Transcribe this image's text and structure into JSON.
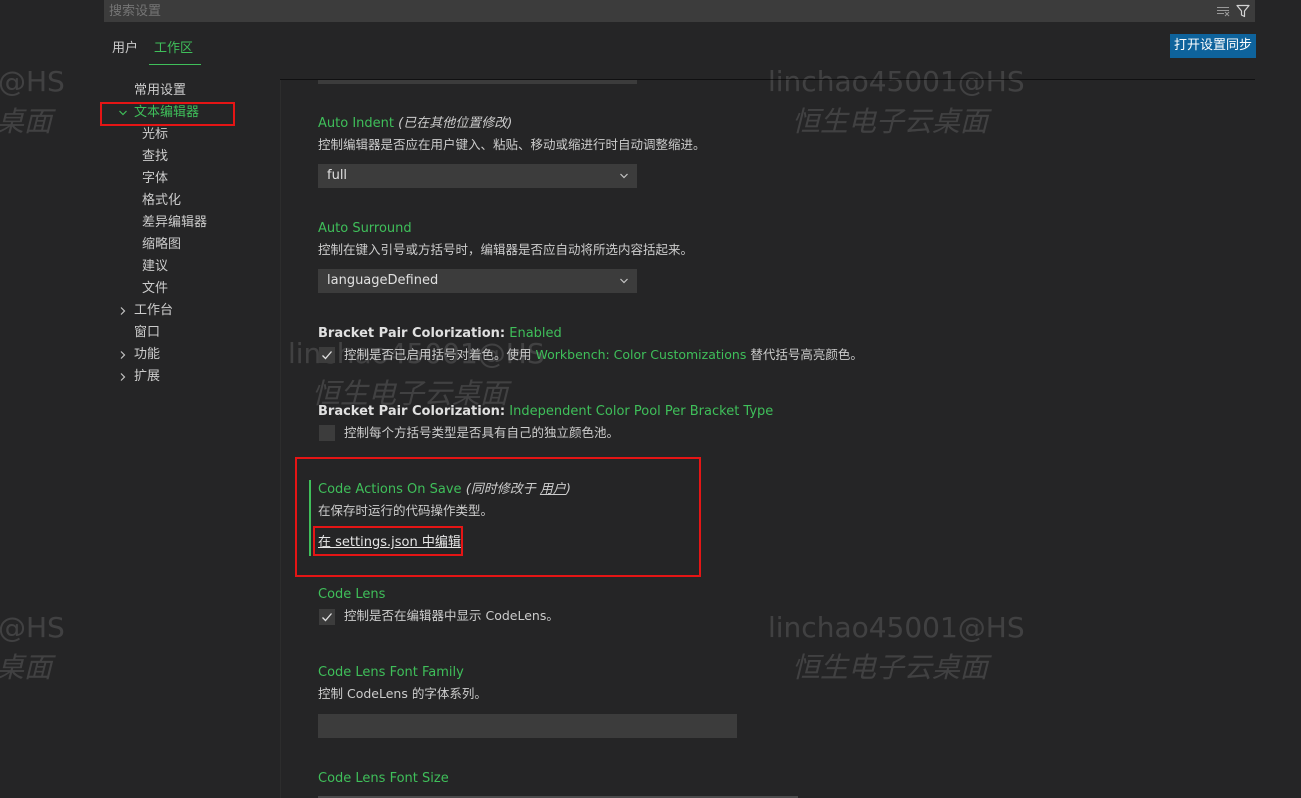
{
  "search": {
    "placeholder": "搜索设置"
  },
  "scope_tabs": {
    "user": "用户",
    "workspace": "工作区"
  },
  "sync_button": "打开设置同步",
  "tree": {
    "common": "常用设置",
    "text_editor": "文本编辑器",
    "text_editor_children": [
      "光标",
      "查找",
      "字体",
      "格式化",
      "差异编辑器",
      "缩略图",
      "建议",
      "文件"
    ],
    "workbench": "工作台",
    "window": "窗口",
    "features": "功能",
    "extensions": "扩展"
  },
  "settings": {
    "auto_indent": {
      "title": "Auto Indent",
      "note": "(已在其他位置修改)",
      "desc": "控制编辑器是否应在用户键入、粘贴、移动或缩进行时自动调整缩进。",
      "value": "full"
    },
    "auto_surround": {
      "title": "Auto Surround",
      "desc": "控制在键入引号或方括号时，编辑器是否应自动将所选内容括起来。",
      "value": "languageDefined"
    },
    "bpc_enabled": {
      "category": "Bracket Pair Colorization:",
      "name": "Enabled",
      "desc_pre": "控制是否已启用括号对着色。使用",
      "desc_link": "Workbench: Color Customizations",
      "desc_post": "替代括号高亮颜色。",
      "checked": true
    },
    "bpc_pool": {
      "category": "Bracket Pair Colorization:",
      "name": "Independent Color Pool Per Bracket Type",
      "desc": "控制每个方括号类型是否具有自己的独立颜色池。",
      "checked": false
    },
    "code_actions": {
      "title": "Code Actions On Save",
      "note_pre": "(同时修改于",
      "note_link": "用户",
      "note_post": ")",
      "desc": "在保存时运行的代码操作类型。",
      "edit_link": "在 settings.json 中编辑"
    },
    "code_lens": {
      "title": "Code Lens",
      "desc": "控制是否在编辑器中显示 CodeLens。",
      "checked": true
    },
    "code_lens_font_family": {
      "title": "Code Lens Font Family",
      "desc": "控制 CodeLens 的字体系列。",
      "value": ""
    },
    "code_lens_font_size": {
      "title": "Code Lens Font Size"
    }
  },
  "watermarks": {
    "account": "linchao45001@HS",
    "account_short": "@HS",
    "desktop": "恒生电子云桌面",
    "desktop_short": "桌面"
  },
  "colors": {
    "accent_green": "#3fbf5a",
    "button_blue": "#0e639c",
    "annotation_red": "#e51515"
  }
}
